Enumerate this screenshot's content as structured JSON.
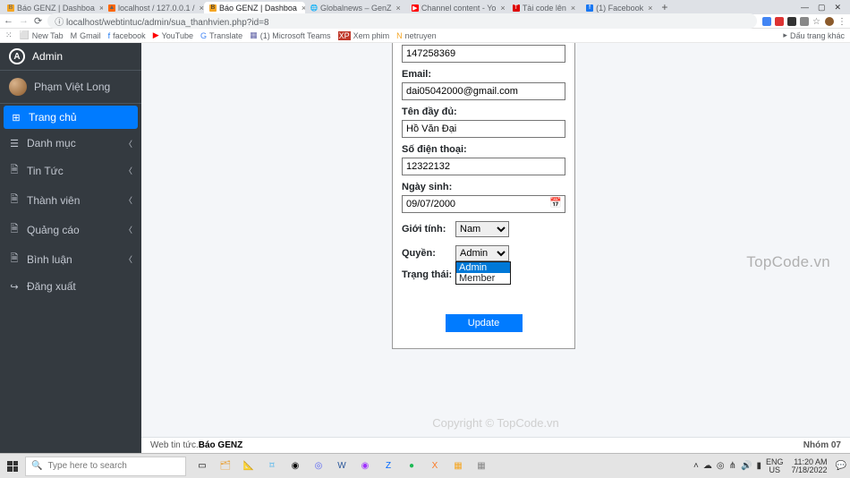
{
  "browser": {
    "tabs": [
      {
        "label": "Báo GENZ | Dashboa"
      },
      {
        "label": "localhost / 127.0.0.1 /"
      },
      {
        "label": "Báo GENZ | Dashboa"
      },
      {
        "label": "Globalnews – GenZ"
      },
      {
        "label": "Channel content - Yo"
      },
      {
        "label": "Tài code lên"
      },
      {
        "label": "(1) Facebook"
      }
    ],
    "url": "localhost/webtintuc/admin/sua_thanhvien.php?id=8",
    "bookmarks": [
      "New Tab",
      "Gmail",
      "facebook",
      "YouTube",
      "Translate",
      "(1) Microsoft Teams",
      "Xem phim",
      "netruyen"
    ],
    "bookmarks_right": "Dấu trang khác"
  },
  "sidebar": {
    "brand": "Admin",
    "user": "Phạm Việt Long",
    "items": [
      {
        "icon": "⊞",
        "label": "Trang chủ",
        "active": true,
        "chev": false
      },
      {
        "icon": "☰",
        "label": "Danh mục",
        "chev": true
      },
      {
        "icon": "🗎",
        "label": "Tin Tức",
        "chev": true
      },
      {
        "icon": "🗎",
        "label": "Thành viên",
        "chev": true
      },
      {
        "icon": "🗎",
        "label": "Quảng cáo",
        "chev": true
      },
      {
        "icon": "🗎",
        "label": "Bình luận",
        "chev": true
      },
      {
        "icon": "↪",
        "label": "Đăng xuất",
        "chev": false
      }
    ]
  },
  "form": {
    "f1_value": "147258369",
    "email_label": "Email:",
    "email_value": "dai05042000@gmail.com",
    "fullname_label": "Tên đầy đủ:",
    "fullname_value": "Hồ Văn Đại",
    "phone_label": "Số điện thoại:",
    "phone_value": "12322132",
    "dob_label": "Ngày sinh:",
    "dob_value": "09/07/2000",
    "gender_label": "Giới tính:",
    "gender_value": "Nam",
    "role_label": "Quyền:",
    "role_value": "Admin",
    "role_options": [
      "Admin",
      "Member"
    ],
    "status_label": "Trạng thái:",
    "submit": "Update"
  },
  "footer": {
    "left_a": "Web tin tức. ",
    "left_b": "Báo GENZ",
    "right": "Nhóm 07"
  },
  "watermarks": {
    "side": "TopCode.vn",
    "logo_a": "TOP",
    "logo_b": "CODE",
    "logo_c": ".VN",
    "copyright": "Copyright © TopCode.vn"
  },
  "taskbar": {
    "search_placeholder": "Type here to search",
    "lang1": "ENG",
    "lang2": "US",
    "time": "11:20 AM",
    "date": "7/18/2022"
  }
}
